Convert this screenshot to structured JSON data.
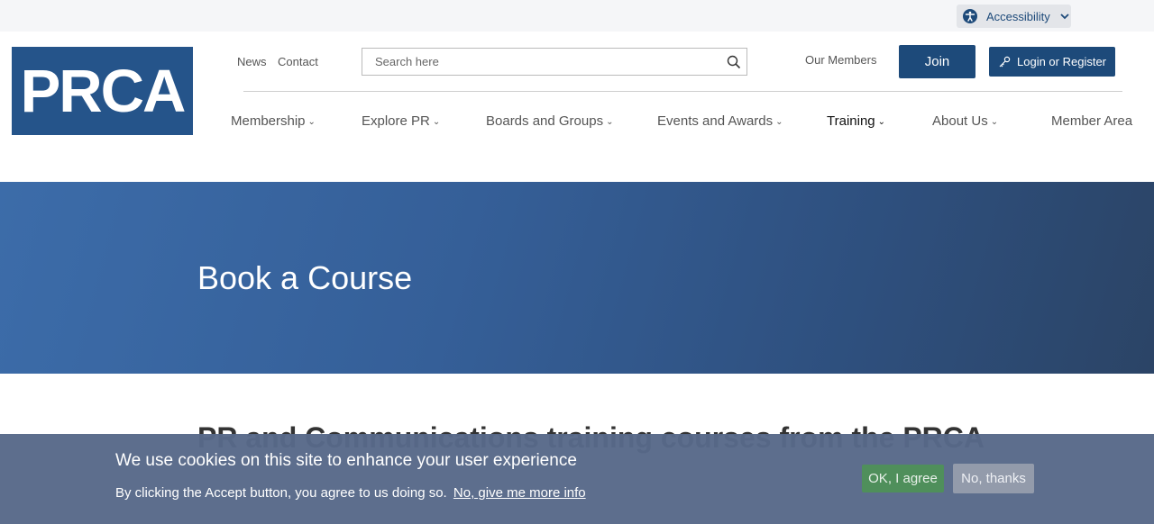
{
  "topbar": {
    "accessibility_label": "Accessibility"
  },
  "logo": {
    "text": "PRCA"
  },
  "header": {
    "news": "News",
    "contact": "Contact",
    "search_placeholder": "Search here",
    "our_members": "Our Members",
    "join": "Join",
    "login": "Login or Register"
  },
  "nav": {
    "items": [
      {
        "label": "Membership",
        "caret": "⌄"
      },
      {
        "label": "Explore PR",
        "caret": "⌄"
      },
      {
        "label": "Boards and Groups",
        "caret": "⌄"
      },
      {
        "label": "Events and Awards",
        "caret": "⌄"
      },
      {
        "label": "Training",
        "caret": "⌄"
      },
      {
        "label": "About Us",
        "caret": "⌄"
      },
      {
        "label": "Member Area",
        "caret": ""
      }
    ],
    "active": "Training"
  },
  "hero": {
    "title": "Book a Course"
  },
  "main": {
    "heading": "PR and Communications training courses from the PRCA"
  },
  "cookie": {
    "title": "We use cookies on this site to enhance your user experience",
    "text": "By clicking the Accept button, you agree to us doing so.",
    "more_link": "No, give me more info",
    "agree": "OK, I agree",
    "decline": "No, thanks"
  },
  "colors": {
    "brand_blue": "#1d4a7a",
    "logo_blue": "#25548a",
    "hero_start": "#3c6ca9",
    "hero_end": "#2b4466",
    "cookie_bg": "#586989",
    "agree_green": "#4f8f5b",
    "decline_grey": "#939bab"
  }
}
